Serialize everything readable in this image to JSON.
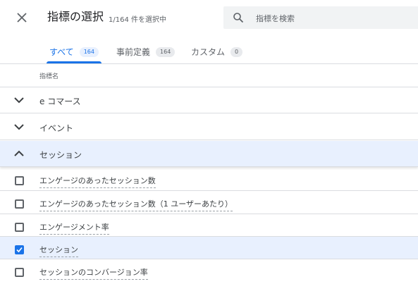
{
  "header": {
    "title": "指標の選択",
    "subtitle": "1/164 件を選択中",
    "search_placeholder": "指標を検索"
  },
  "tabs": [
    {
      "label": "すべて",
      "count": "164",
      "active": true
    },
    {
      "label": "事前定義",
      "count": "164",
      "active": false
    },
    {
      "label": "カスタム",
      "count": "0",
      "active": false
    }
  ],
  "table": {
    "column_header": "指標名",
    "groups": [
      {
        "label": "e コマース",
        "expanded": false
      },
      {
        "label": "イベント",
        "expanded": false
      },
      {
        "label": "セッション",
        "expanded": true
      }
    ],
    "metrics": [
      {
        "label": "エンゲージのあったセッション数",
        "checked": false
      },
      {
        "label": "エンゲージのあったセッション数（1 ユーザーあたり）",
        "checked": false
      },
      {
        "label": "エンゲージメント率",
        "checked": false
      },
      {
        "label": "セッション",
        "checked": true
      },
      {
        "label": "セッションのコンバージョン率",
        "checked": false
      }
    ]
  },
  "colors": {
    "accent": "#1a73e8",
    "selected_row": "#e8f0fe"
  }
}
